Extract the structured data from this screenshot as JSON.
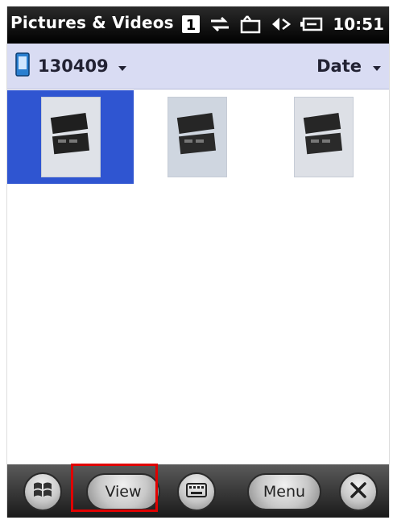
{
  "title_bar": {
    "app_title": "Pictures & Videos",
    "clock": "10:51",
    "icons": [
      "notification-1-icon",
      "connectivity-icon",
      "message-icon",
      "volume-icon",
      "battery-icon"
    ]
  },
  "filter_bar": {
    "folder_label": "130409",
    "sort_label": "Date"
  },
  "thumbnails": [
    {
      "selected": true
    },
    {
      "selected": false
    },
    {
      "selected": false
    }
  ],
  "softkeys": {
    "left_label": "View",
    "right_label": "Menu",
    "icons": [
      "windows-start-icon",
      "keyboard-icon",
      "close-icon"
    ]
  },
  "colors": {
    "selection": "#2f55d1",
    "filter_bar": "#d9dcf3",
    "highlight": "#e00000"
  }
}
